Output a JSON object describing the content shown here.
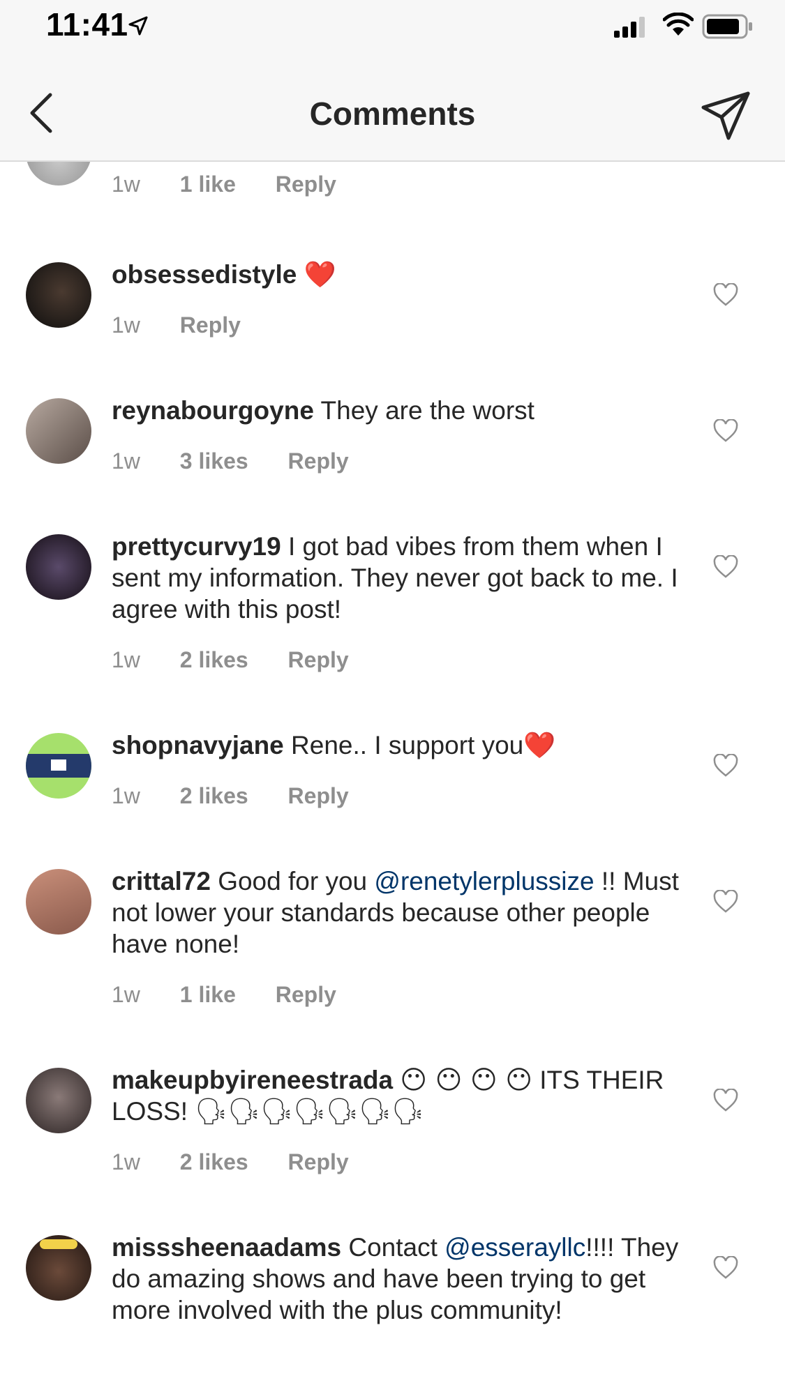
{
  "status_bar": {
    "time": "11:41"
  },
  "header": {
    "title": "Comments"
  },
  "top_partial": {
    "time": "1w",
    "likes": "1 like",
    "reply": "Reply"
  },
  "comments": [
    {
      "username": "obsessedistyle",
      "text": "",
      "emoji": "❤️",
      "time": "1w",
      "likes": "",
      "reply": "Reply"
    },
    {
      "username": "reynabourgoyne",
      "text": "They are the worst",
      "time": "1w",
      "likes": "3 likes",
      "reply": "Reply"
    },
    {
      "username": "prettycurvy19",
      "text": "I got bad vibes from them when I sent my information. They never got back to me. I agree with this post!",
      "time": "1w",
      "likes": "2 likes",
      "reply": "Reply"
    },
    {
      "username": "shopnavyjane",
      "text": "Rene.. I support you",
      "emoji": "❤️",
      "time": "1w",
      "likes": "2 likes",
      "reply": "Reply"
    },
    {
      "username": "crittal72",
      "text_before": "Good for you",
      "mention": "@renetylerplussize",
      "text_after": "!! Must not lower your standards because other people have none!",
      "time": "1w",
      "likes": "1 like",
      "reply": "Reply"
    },
    {
      "username": "makeupbyireneestrada",
      "emoji_before": "😶 😶 😶 😶",
      "text": "ITS THEIR LOSS!",
      "emoji_after": "🗣🗣🗣🗣🗣🗣🗣",
      "time": "1w",
      "likes": "2 likes",
      "reply": "Reply"
    },
    {
      "username": "misssheenaadams",
      "text_before": "Contact",
      "mention": "@esserayllc",
      "text_after": "!!!! They do amazing shows and have been trying to get more involved with the plus community!"
    }
  ]
}
